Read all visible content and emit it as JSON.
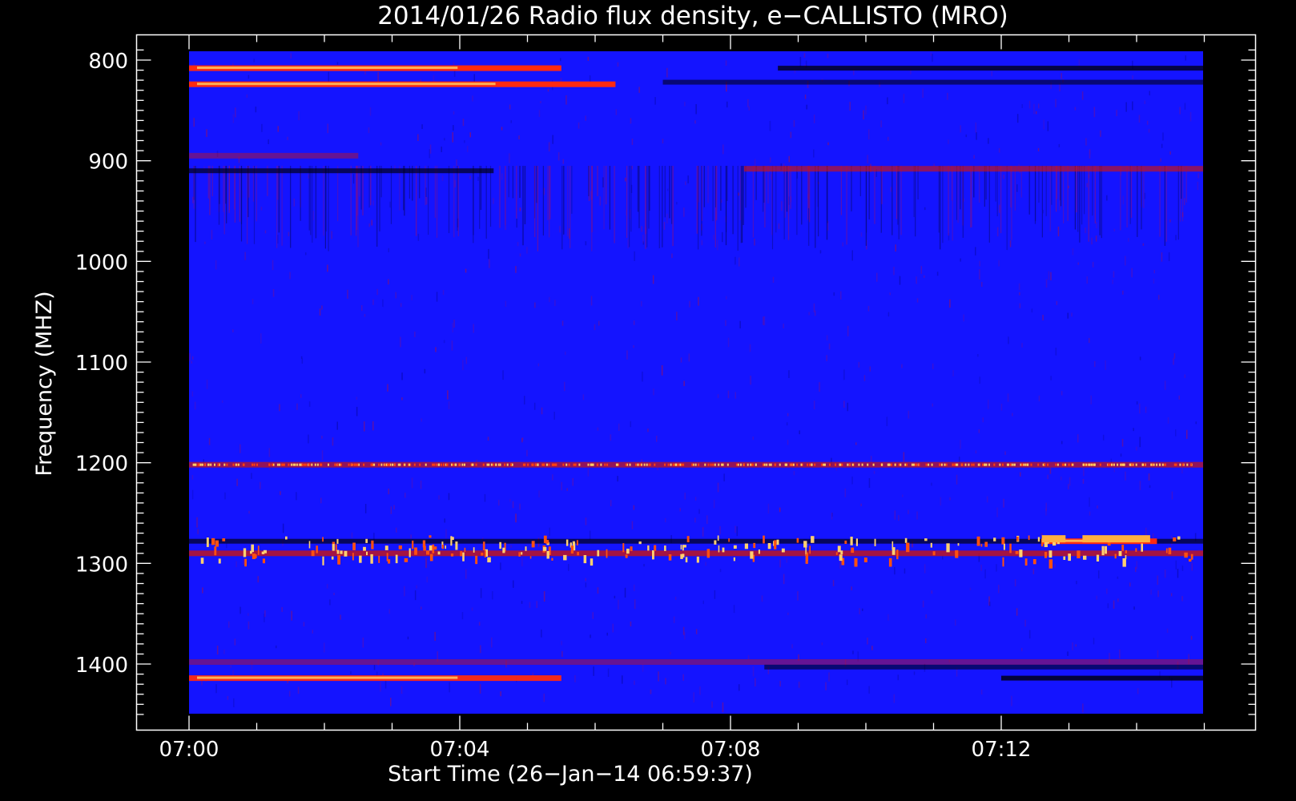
{
  "chart_data": {
    "type": "heatmap",
    "title": "2014/01/26  Radio flux density, e−CALLISTO (MRO)",
    "xlabel": "Start Time (26−Jan−14 06:59:37)",
    "ylabel": "Frequency (MHZ)",
    "x_ticks": [
      "07:00",
      "07:04",
      "07:08",
      "07:12"
    ],
    "x_tick_minutes": [
      0,
      4,
      8,
      12
    ],
    "x_range_minutes": [
      0,
      15
    ],
    "y_ticks": [
      800,
      900,
      1000,
      1100,
      1200,
      1300,
      1400
    ],
    "ylim": [
      1450,
      790
    ],
    "colormap": [
      "#000000",
      "#1414ff",
      "#d81010",
      "#ff6a00",
      "#ffe8a0"
    ],
    "features": [
      {
        "kind": "bright",
        "freq_mhz": 808,
        "start_min": 0,
        "end_min": 5.5,
        "intensity": 1.0
      },
      {
        "kind": "bright",
        "freq_mhz": 824,
        "start_min": 0,
        "end_min": 6.3,
        "intensity": 0.9
      },
      {
        "kind": "dark",
        "freq_mhz": 808,
        "start_min": 8.7,
        "end_min": 15,
        "intensity": 0.8
      },
      {
        "kind": "dark",
        "freq_mhz": 822,
        "start_min": 7,
        "end_min": 15,
        "intensity": 0.6
      },
      {
        "kind": "dark",
        "freq_mhz": 910,
        "start_min": 0,
        "end_min": 4.5,
        "intensity": 0.7
      },
      {
        "kind": "bright",
        "freq_mhz": 908,
        "start_min": 8.2,
        "end_min": 15,
        "intensity": 0.55
      },
      {
        "kind": "bright",
        "freq_mhz": 895,
        "start_min": 0,
        "end_min": 2.5,
        "intensity": 0.35
      },
      {
        "kind": "bright",
        "freq_mhz": 1202,
        "start_min": 0,
        "end_min": 15,
        "intensity": 0.6
      },
      {
        "kind": "dark",
        "freq_mhz": 1278,
        "start_min": 0,
        "end_min": 15,
        "intensity": 0.7
      },
      {
        "kind": "bright",
        "freq_mhz": 1290,
        "start_min": 0,
        "end_min": 15,
        "intensity": 0.7
      },
      {
        "kind": "bright",
        "freq_mhz": 1278,
        "start_min": 12.6,
        "end_min": 14.3,
        "intensity": 1.0
      },
      {
        "kind": "bright",
        "freq_mhz": 1398,
        "start_min": 0,
        "end_min": 15,
        "intensity": 0.35
      },
      {
        "kind": "bright",
        "freq_mhz": 1414,
        "start_min": 0,
        "end_min": 5.5,
        "intensity": 0.85
      },
      {
        "kind": "dark",
        "freq_mhz": 1403,
        "start_min": 8.5,
        "end_min": 15,
        "intensity": 0.6
      },
      {
        "kind": "dark",
        "freq_mhz": 1414,
        "start_min": 12,
        "end_min": 15,
        "intensity": 0.85
      }
    ]
  }
}
